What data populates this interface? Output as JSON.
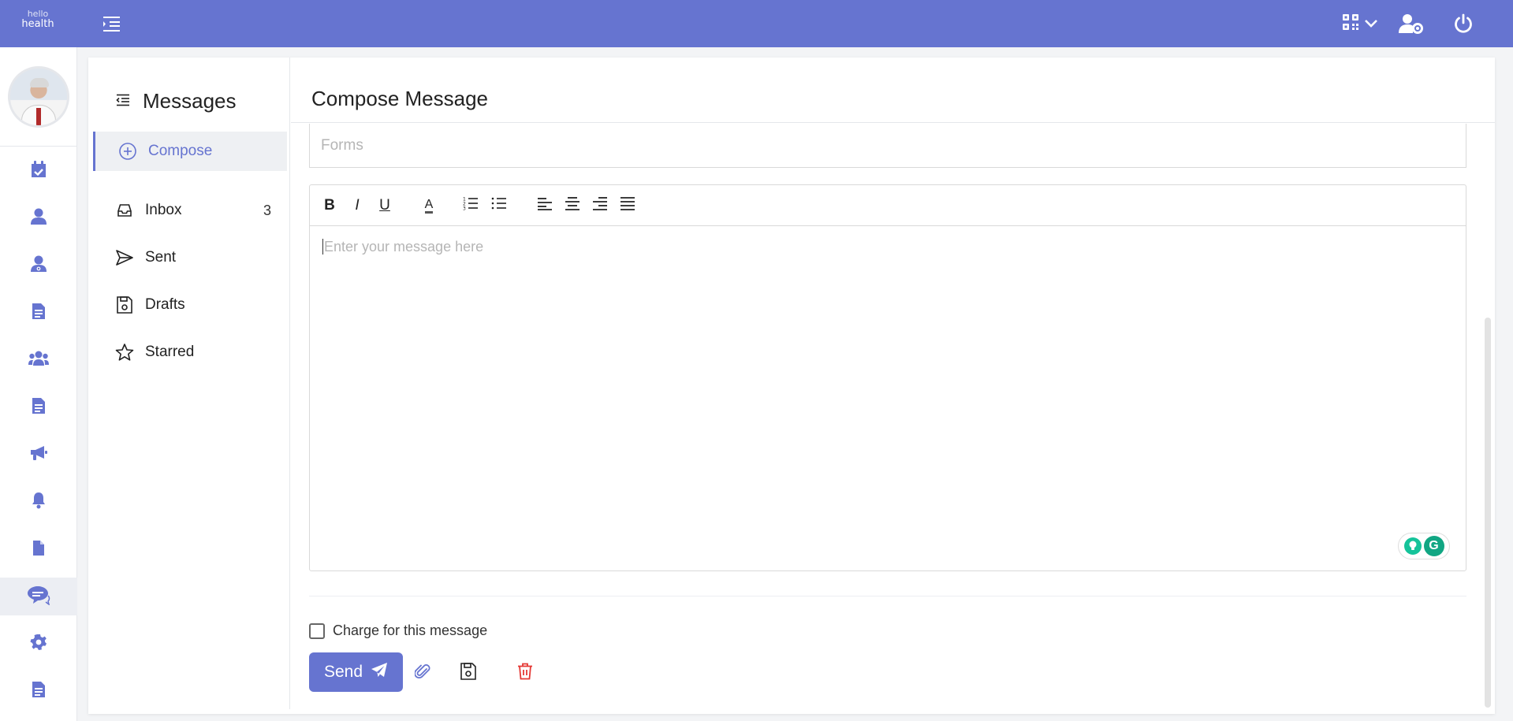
{
  "brand": {
    "line1": "hello",
    "line2": "health"
  },
  "colors": {
    "accent": "#6674d0",
    "danger": "#e53935",
    "topbar": "#6674d0"
  },
  "topbar_icons": [
    "menu-toggle-icon",
    "qr-code-icon",
    "chevron-down-icon",
    "user-settings-icon",
    "power-icon"
  ],
  "sidebar": {
    "icons": [
      "calendar-check-icon",
      "user-icon",
      "doctor-icon",
      "document-list-icon",
      "users-group-icon",
      "document-icon",
      "megaphone-icon",
      "bell-icon",
      "file-icon",
      "chat-icon",
      "gear-icon",
      "report-icon"
    ],
    "active": "chat-icon"
  },
  "messages": {
    "title": "Messages",
    "folders": [
      {
        "label": "Compose",
        "icon": "plus-circle-icon",
        "count": ""
      },
      {
        "label": "Inbox",
        "icon": "inbox-icon",
        "count": "3"
      },
      {
        "label": "Sent",
        "icon": "send-icon",
        "count": ""
      },
      {
        "label": "Drafts",
        "icon": "save-icon",
        "count": ""
      },
      {
        "label": "Starred",
        "icon": "star-icon",
        "count": ""
      }
    ]
  },
  "compose": {
    "title": "Compose Message",
    "forms_placeholder": "Forms",
    "editor_placeholder": "Enter your message here",
    "toolbar": {
      "bold": "B",
      "italic": "I",
      "underline": "U",
      "font_color": "A"
    },
    "charge_label": "Charge for this message",
    "send_label": "Send"
  }
}
